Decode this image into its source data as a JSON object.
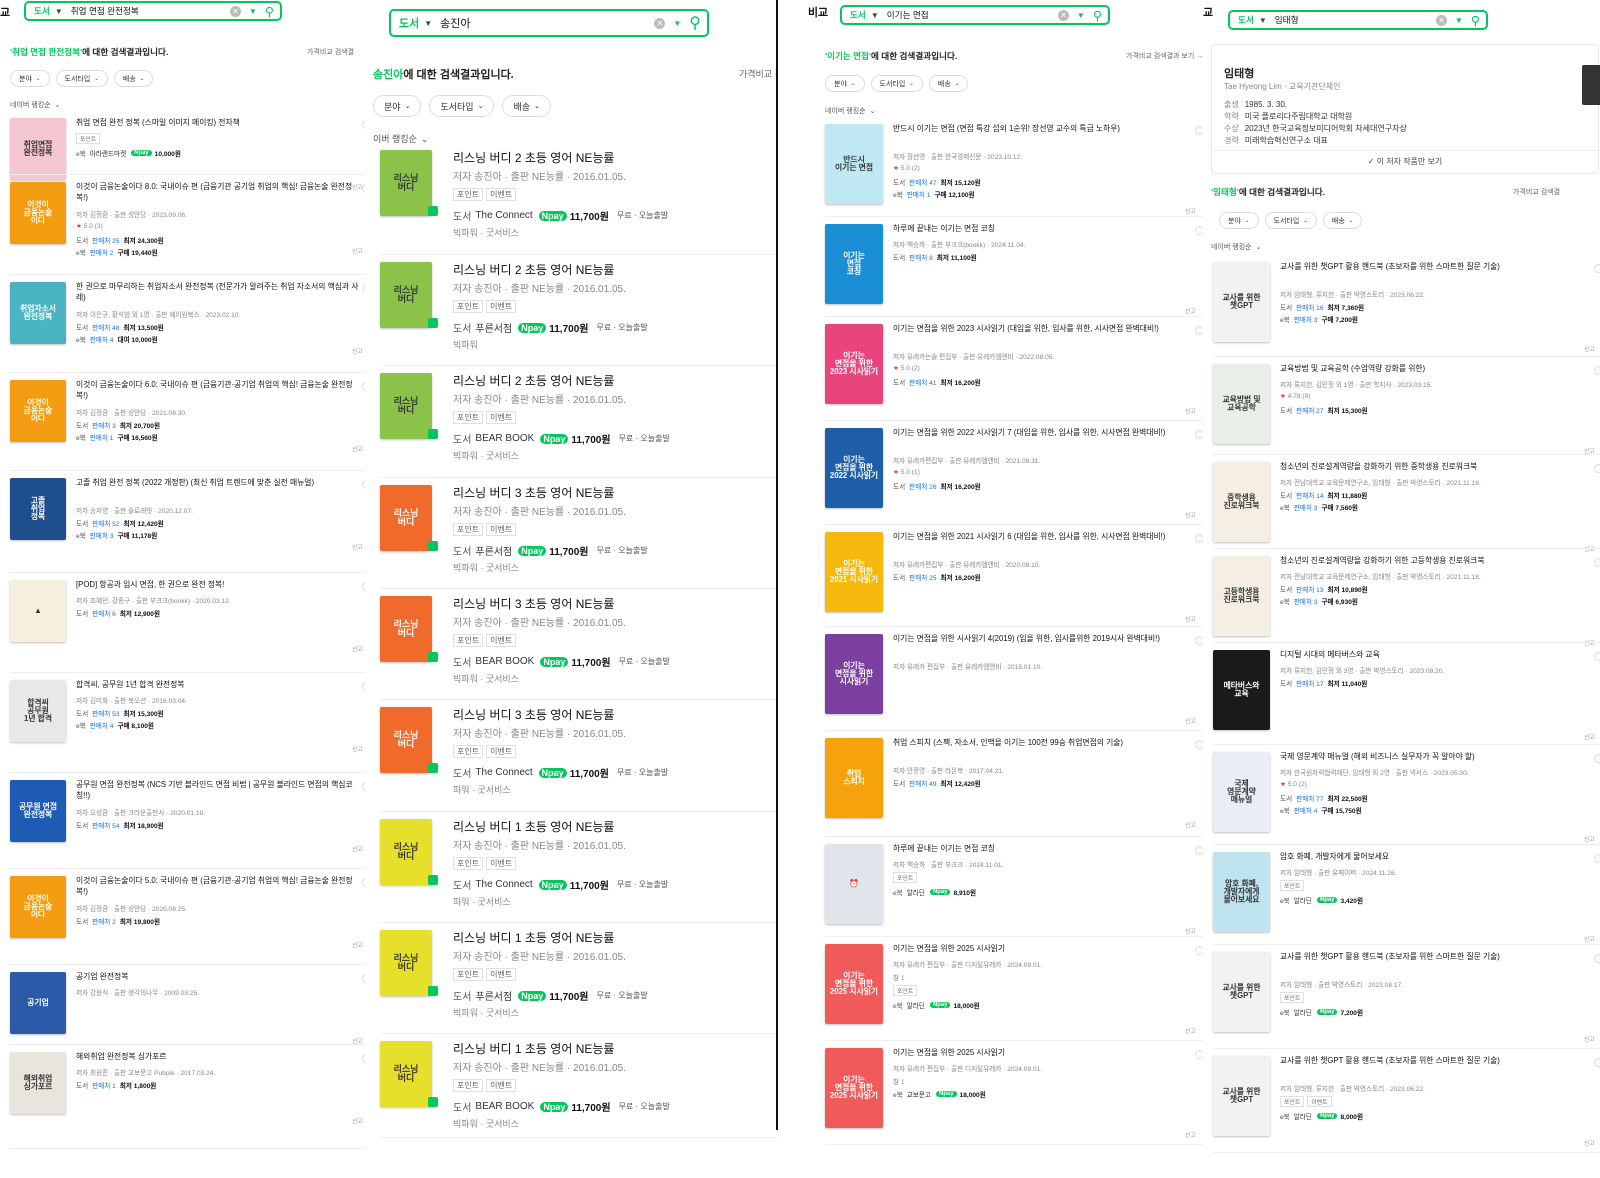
{
  "panels": {
    "p1": {
      "edge_label": "교",
      "search": {
        "category": "도서",
        "query": "취업 면접 완전정복"
      },
      "result": {
        "query": "'취업 면접 완전정복'",
        "suffix": "에 대한 검색결과입니다."
      },
      "price_compare": "가격비교 검색결",
      "filters": [
        "분야",
        "도서타입",
        "배송"
      ],
      "sort": "네이버 랭킹순",
      "items": [
        {
          "title": "취업 면접 완전 정복 (스마일 이미지 메이킹) 전자책",
          "badges": [
            "포인트"
          ],
          "lines": [
            {
              "type": "e북",
              "store": "아라랜드마켓",
              "npay": true,
              "price": "10,000원"
            }
          ],
          "cover": "#f4c6cf",
          "cover_text": "취업면접\n완전정복"
        },
        {
          "title": "이것이 금융논술이다 8.0: 국내이슈 편 (금융기관 공기업 취업의 핵심! 금융논술 완전정복!)",
          "meta": "저자 김정환 · 출판 성안당 · 2023.09.06.",
          "rating": "5.0 (3)",
          "lines": [
            {
              "type": "도서",
              "sellers": "판매처 25",
              "price": "최저 24,300원"
            },
            {
              "type": "e북",
              "sellers": "판매처 2",
              "price": "구매 19,440원"
            }
          ],
          "cover": "#f39c12",
          "cover_text": "이것이\n금융논술\n이다"
        },
        {
          "title": "한 권으로 마무리하는 취업자소서 완전정복 (전문가가 알려주는 취업 자소서의 핵심과 사례)",
          "meta": "저자 이은규, 황석범 외 1명 · 출판 예이원북스 · 2023.02.10.",
          "lines": [
            {
              "type": "도서",
              "sellers": "판매처 48",
              "price": "최저 13,500원"
            },
            {
              "type": "e북",
              "sellers": "판매처 4",
              "price": "대여 10,000원"
            }
          ],
          "cover": "#4ab3c4",
          "cover_text": "취업자소서\n완전정복"
        },
        {
          "title": "이것이 금융논술이다 6.0: 국내이슈 편 (금융기관·공기업 취업의 핵심! 금융논술 완전정복!)",
          "meta": "저자 김정환 · 출판 성안당 · 2021.08.30.",
          "lines": [
            {
              "type": "도서",
              "sellers": "판매처 3",
              "price": "최저 20,700원"
            },
            {
              "type": "e북",
              "sellers": "판매처 1",
              "price": "구매 16,560원"
            }
          ],
          "cover": "#f39c12",
          "cover_text": "이것이\n금융논술\n이다"
        },
        {
          "title": "고졸 취업 완전 정복 (2022 개정판) (최신 취업 트렌드에 맞춘 실전 매뉴얼)",
          "meta": "저자 송지영 · 출판 슬로래빗 · 2020.12.07.",
          "lines": [
            {
              "type": "도서",
              "sellers": "판매처 52",
              "price": "최저 12,420원"
            },
            {
              "type": "e북",
              "sellers": "판매처 3",
              "price": "구매 11,178원"
            }
          ],
          "cover": "#1f4e8c",
          "cover_text": "고졸\n취업\n정복"
        },
        {
          "title": "[POD] 항공과 입시 면접, 한 권으로 완전 정복!",
          "meta": "저자 조혜민, 강종구 · 출판 부크크(bookk) · 2020.03.12.",
          "lines": [
            {
              "type": "도서",
              "sellers": "판매처 6",
              "price": "최저 12,900원"
            }
          ],
          "cover": "#f5efe0",
          "cover_text": "▲"
        },
        {
          "title": "합격씨, 공무원 1년 합격 완전정복",
          "meta": "저자 김미화 · 출판 북오션 · 2016.03.04.",
          "lines": [
            {
              "type": "도서",
              "sellers": "판매처 53",
              "price": "최저 15,300원"
            },
            {
              "type": "e북",
              "sellers": "판매처 4",
              "price": "구매 8,100원"
            }
          ],
          "cover": "#e8e8e8",
          "cover_text": "합격씨\n공무원\n1년 합격"
        },
        {
          "title": "공무원 면접 완전정복 (NCS 기반 블라인드 면접 비법 | 공무원 블라인드 면접의 핵심코칭!!)",
          "meta": "저자 오성환 · 출판 크라운출판사 · 2020.01.10.",
          "lines": [
            {
              "type": "도서",
              "sellers": "판매처 54",
              "price": "최저 18,900원"
            }
          ],
          "cover": "#1e5bb5",
          "cover_text": "공무원 면접\n완전정복"
        },
        {
          "title": "이것이 금융논술이다 5.0: 국내이슈 편 (금융기관·공기업 취업의 핵심! 금융논술 완전정복!)",
          "meta": "저자 김정환 · 출판 성안당 · 2020.08.25.",
          "lines": [
            {
              "type": "도서",
              "sellers": "판매처 2",
              "price": "최저 19,800원"
            }
          ],
          "cover": "#f39c12",
          "cover_text": "이것이\n금융논술\n이다"
        },
        {
          "title": "공기업 완전정복",
          "meta": "저자 강용식 · 출판 생각의나무 · 2009.09.25.",
          "lines": [],
          "cover": "#2a5aa8",
          "cover_text": "공기업"
        },
        {
          "title": "해외취업 완전정복 싱가포르",
          "meta": "저자 최원준 · 출판 교보문고 Pubple · 2017.03.24.",
          "lines": [
            {
              "type": "도서",
              "sellers": "판매처 1",
              "price": "최저 1,800원"
            }
          ],
          "cover": "#e9e4dc",
          "cover_text": "해외취업\n싱가포르"
        }
      ]
    },
    "p2": {
      "search": {
        "category": "도서",
        "query": "송진아"
      },
      "result": {
        "query": "송진아",
        "suffix": "에 대한 검색결과입니다."
      },
      "price_compare": "가격비교 검색결과",
      "filters": [
        "분야",
        "도서타입",
        "배송"
      ],
      "sort": "이버 랭킹순",
      "items": [
        {
          "title": "리스닝 버디 2 초등 영어 NE능률",
          "meta": "저자 송진아 · 출판 NE능률 · 2016.01.05.",
          "store": "The Connect",
          "price": "11,700원",
          "ship": "무료 · 오늘출발",
          "ext": "빅파워 · 굿서비스",
          "cover": "#8bc34a"
        },
        {
          "title": "리스닝 버디 2 초등 영어 NE능률",
          "meta": "저자 송진아 · 출판 NE능률 · 2016.01.05.",
          "store": "푸른서점",
          "price": "11,700원",
          "ship": "무료 · 오늘출발",
          "ext": "빅파워",
          "cover": "#8bc34a"
        },
        {
          "title": "리스닝 버디 2 초등 영어 NE능률",
          "meta": "저자 송진아 · 출판 NE능률 · 2016.01.05.",
          "store": "BEAR BOOK",
          "price": "11,700원",
          "ship": "무료 · 오늘출발",
          "ext": "빅파워 · 굿서비스",
          "cover": "#8bc34a"
        },
        {
          "title": "리스닝 버디 3 초등 영어 NE능률",
          "meta": "저자 송진아 · 출판 NE능률 · 2016.01.05.",
          "store": "푸른서점",
          "price": "11,700원",
          "ship": "무료 · 오늘출발",
          "ext": "빅파워 · 굿서비스",
          "cover": "#f06a2b"
        },
        {
          "title": "리스닝 버디 3 초등 영어 NE능률",
          "meta": "저자 송진아 · 출판 NE능률 · 2016.01.05.",
          "store": "BEAR BOOK",
          "price": "11,700원",
          "ship": "무료 · 오늘출발",
          "ext": "빅파워 · 굿서비스",
          "cover": "#f06a2b"
        },
        {
          "title": "리스닝 버디 3 초등 영어 NE능률",
          "meta": "저자 송진아 · 출판 NE능률 · 2016.01.05.",
          "store": "The Connect",
          "price": "11,700원",
          "ship": "무료 · 오늘출발",
          "ext": "파워 · 굿서비스",
          "cover": "#f06a2b"
        },
        {
          "title": "리스닝 버디 1 초등 영어 NE능률",
          "meta": "저자 송진아 · 출판 NE능률 · 2016.01.05.",
          "store": "The Connect",
          "price": "11,700원",
          "ship": "무료 · 오늘출발",
          "ext": "파워 · 굿서비스",
          "cover": "#e6e02b"
        },
        {
          "title": "리스닝 버디 1 초등 영어 NE능률",
          "meta": "저자 송진아 · 출판 NE능률 · 2016.01.05.",
          "store": "푸른서점",
          "price": "11,700원",
          "ship": "무료 · 오늘출발",
          "ext": "빅파워 · 굿서비스",
          "cover": "#e6e02b"
        },
        {
          "title": "리스닝 버디 1 초등 영어 NE능률",
          "meta": "저자 송진아 · 출판 NE능률 · 2016.01.05.",
          "store": "BEAR BOOK",
          "price": "11,700원",
          "ship": "무료 · 오늘출발",
          "ext": "빅파워 · 굿서비스",
          "cover": "#e6e02b"
        }
      ]
    },
    "p3": {
      "edge_label": "비교",
      "search": {
        "category": "도서",
        "query": "이기는 면접"
      },
      "result": {
        "query": "'이기는 면접'",
        "suffix": "에 대한 검색결과입니다."
      },
      "price_compare": "가격비교 검색결과 보기 →",
      "filters": [
        "분야",
        "도서타입",
        "배송"
      ],
      "sort": "네이버 랭킹순",
      "items": [
        {
          "title": "반드시 이기는 면접 (면접 특강 섭외 1순위! 장선영 교수의 특급 노하우)",
          "meta": "저자 장선영 · 출판 한국경제신문 · 2023.10.12.",
          "rating": "5.0 (2)",
          "lines": [
            {
              "type": "도서",
              "sellers": "판매처 47",
              "price": "최저 15,120원"
            },
            {
              "type": "e북",
              "sellers": "판매처 1",
              "price": "구매 12,100원"
            }
          ],
          "cover": "#bfe8f2",
          "cover_text": "반드시\n이기는 면접"
        },
        {
          "title": "하루에 끝내는 이기는 면접 코칭",
          "meta": "저자 백승하 · 출판 부크크(bookk) · 2024.11.04.",
          "lines": [
            {
              "type": "도서",
              "sellers": "판매처 8",
              "price": "최저 11,100원"
            }
          ],
          "cover": "#1b8fd6",
          "cover_text": "이기는\n면접\n코칭"
        },
        {
          "title": "이기는 면접을 위한 2023 시사읽기 (대입을 위한, 입사를 위한, 시사면접 완벽대비!)",
          "meta": "저자 유레카논술 편집부 · 출판 유레카엠앤비 · 2022.08.05.",
          "rating": "5.0 (2)",
          "lines": [
            {
              "type": "도서",
              "sellers": "판매처 41",
              "price": "최저 16,200원"
            }
          ],
          "cover": "#e8457c",
          "cover_text": "이기는\n면접을 위한\n2023 시사읽기"
        },
        {
          "title": "이기는 면접을 위한 2022 시사읽기 7 (대입을 위한, 입사를 위한, 시사면접 완벽대비!)",
          "meta": "저자 유레카편집부 · 출판 유레카엠앤비 · 2021.08.31.",
          "rating": "5.0 (1)",
          "lines": [
            {
              "type": "도서",
              "sellers": "판매처 26",
              "price": "최저 16,200원"
            }
          ],
          "cover": "#1f5fa8",
          "cover_text": "이기는\n면접을 위한\n2022 시사읽기"
        },
        {
          "title": "이기는 면접을 위한 2021 시사읽기 6 (대입을 위한, 입사를 위한, 시사면접 완벽대비!)",
          "meta": "저자 유레카편집부 · 출판 유레카엠앤비 · 2020.08.10.",
          "lines": [
            {
              "type": "도서",
              "sellers": "판매처 25",
              "price": "최저 16,200원"
            }
          ],
          "cover": "#f5b80d",
          "cover_text": "이기는\n면접을 위한\n2021 시사읽기"
        },
        {
          "title": "이기는 면접을 위한 시사읽기 4(2019) (입을 위한, 입사를위한 2019시사 완벽대비!)",
          "meta": "저자 유레카 편집부 · 출판 유레카엠앤비 · 2019.01.10.",
          "lines": [],
          "cover": "#7b3fa0",
          "cover_text": "이기는\n면접을 위한\n시사읽기"
        },
        {
          "title": "취업 스피치 (스펙, 자소서, 인맥을 이기는 100전 99승 취업면접의 기술)",
          "meta": "저자 안정명 · 출판 라온북 · 2017.04.21.",
          "lines": [
            {
              "type": "도서",
              "sellers": "판매처 49",
              "price": "최저 12,420원"
            }
          ],
          "cover": "#f5a20d",
          "cover_text": "취업\n스피치"
        },
        {
          "title": "하루에 끝내는 이기는 면접 코칭",
          "meta": "저자 백승하 · 출판 부크크 · 2024.11.01.",
          "badges": [
            "포인트"
          ],
          "lines": [
            {
              "type": "e북",
              "store": "알라딘",
              "npay": true,
              "price": "8,910원"
            }
          ],
          "cover": "#dfe5ea",
          "cover_text": "⏰"
        },
        {
          "title": "이기는 면접을 위한 2025 시사읽기",
          "meta": "저자 유레카 편집부 · 출판 디지털유레카 · 2024.09.01.",
          "vol": "참 1",
          "badges": [
            "포인트"
          ],
          "lines": [
            {
              "type": "e북",
              "store": "알라딘",
              "npay": true,
              "price": "18,000원"
            }
          ],
          "cover": "#f05a5a",
          "cover_text": "이기는\n면접을 위한\n2025 시사읽기"
        },
        {
          "title": "이기는 면접을 위한 2025 시사읽기",
          "meta": "저자 유레카 편집부 · 출판 디지털유레카 · 2024.09.01.",
          "vol": "참 1",
          "lines": [
            {
              "type": "e북",
              "store": "교보문고",
              "npay": true,
              "price": "18,000원"
            }
          ],
          "cover": "#f05a5a",
          "cover_text": "이기는\n면접을 위한\n2025 시사읽기"
        }
      ]
    },
    "p4": {
      "edge_label": "교",
      "search": {
        "category": "도서",
        "query": "임태형"
      },
      "author": {
        "name": "임태형",
        "roman": "Tae Hyeong Lim",
        "field": "교육기관단체인",
        "birth_label": "출생",
        "birth": "1985. 3. 30.",
        "school_label": "학력",
        "school": "미국 플로리다주립대학교 대학원",
        "award_label": "수상",
        "award": "2023년 한국교육정보미디어학회 차세대연구자상",
        "career_label": "경력",
        "career": "미래학습혁신연구소 대표",
        "more": "✓ 이 저자 작품만 보기"
      },
      "result": {
        "query": "'임태형'",
        "suffix": "에 대한 검색결과입니다."
      },
      "price_compare": "가격비교 검색결",
      "filters": [
        "분야",
        "도서타입",
        "배송"
      ],
      "sort": "네이버 랭킹순",
      "items": [
        {
          "title": "교사를 위한 챗GPT 활용 핸드북 (초보자를 위한 스마트한 질문 기술)",
          "meta": "저자 임태형, 류지헌 · 출판 박영스토리 · 2023.06.22.",
          "lines": [
            {
              "type": "도서",
              "sellers": "판매처 16",
              "price": "최저 7,360원"
            },
            {
              "type": "e북",
              "sellers": "판매처 3",
              "price": "구매 7,200원"
            }
          ],
          "cover": "#f2f2f2",
          "cover_text": "교사를 위한\n챗GPT"
        },
        {
          "title": "교육방법 및 교육공학 (수업역량 강화를 위한)",
          "meta": "저자 류지헌, 김민정 외 1명 · 출판 학지사 · 2023.03.15.",
          "rating": "4.78 (9)",
          "lines": [
            {
              "type": "도서",
              "sellers": "판매처 27",
              "price": "최저 15,300원"
            }
          ],
          "cover": "#e8efe8",
          "cover_text": "교육방법 및\n교육공학"
        },
        {
          "title": "청소년의 진로설계역량을 강화하기 위한 중학생용 진로워크북",
          "meta": "저자 전남대학교 교육문제연구소, 임태형 · 출판 박영스토리 · 2021.11.18.",
          "lines": [
            {
              "type": "도서",
              "sellers": "판매처 14",
              "price": "최저 11,880원"
            },
            {
              "type": "e북",
              "sellers": "판매처 3",
              "price": "구매 7,560원"
            }
          ],
          "cover": "#f4efe2",
          "cover_text": "중학생용\n진로워크북"
        },
        {
          "title": "청소년의 진로설계역량을 강화하기 위한 고등학생용 진로워크북",
          "meta": "저자 전남대학교 교육문제연구소, 임태형 · 출판 박영스토리 · 2021.11.18.",
          "lines": [
            {
              "type": "도서",
              "sellers": "판매처 13",
              "price": "최저 10,890원"
            },
            {
              "type": "e북",
              "sellers": "판매처 3",
              "price": "구매 6,930원"
            }
          ],
          "cover": "#f4efe2",
          "cover_text": "고등학생용\n진로워크북"
        },
        {
          "title": "디지털 시대의 메타버스와 교육",
          "meta": "저자 류지헌, 김민정 외 3명 · 출판 박영스토리 · 2023.08.20.",
          "lines": [
            {
              "type": "도서",
              "sellers": "판매처 17",
              "price": "최저 11,040원"
            }
          ],
          "cover": "#1a1a1a",
          "cover_text": "메타버스와\n교육"
        },
        {
          "title": "국제 영문계약 매뉴얼 (해외 비즈니스 실무자가 꼭 알아야 할)",
          "meta": "저자 한국원자력협력재단, 임태형 외 2명 · 출판 넥서스 · 2023.05.30.",
          "rating": "5.0 (2)",
          "lines": [
            {
              "type": "도서",
              "sellers": "판매처 77",
              "price": "최저 22,500원"
            },
            {
              "type": "e북",
              "sellers": "판매처 4",
              "price": "구매 15,750원"
            }
          ],
          "cover": "#e9eef4",
          "cover_text": "국제\n영문계약\n매뉴얼"
        },
        {
          "title": "암호 화폐, 개발자에게 물어보세요",
          "meta": "저자 임태형 · 출판 유페이퍼 · 2024.11.26.",
          "badges": [
            "포인트"
          ],
          "lines": [
            {
              "type": "e북",
              "store": "알라딘",
              "npay": true,
              "price": "3,420원"
            }
          ],
          "cover": "#bfe3ef",
          "cover_text": "암호 화폐,\n개발자에게\n물어보세요"
        },
        {
          "title": "교사를 위한 챗GPT 활용 핸드북 (초보자를 위한 스마트한 질문 기술)",
          "meta": "저자 임태형 · 출판 박영스토리 · 2023.08.17.",
          "badges": [
            "포인트"
          ],
          "lines": [
            {
              "type": "e북",
              "store": "알라딘",
              "npay": true,
              "price": "7,200원"
            }
          ],
          "cover": "#f2f2f2",
          "cover_text": "교사를 위한\n챗GPT"
        },
        {
          "title": "교사를 위한 챗GPT 활용 핸드북 (초보자를 위한 스마트한 질문 기술)",
          "meta": "저자 임태형, 류지헌 · 출판 박영스토리 · 2023.06.22.",
          "badges": [
            "포인트",
            "이벤트"
          ],
          "lines": [
            {
              "type": "e북",
              "store": "알라딘",
              "npay": true,
              "price": "8,000원"
            }
          ],
          "cover": "#f2f2f2",
          "cover_text": "교사를 위한\n챗GPT"
        }
      ]
    }
  },
  "common": {
    "report": "신고",
    "heart": "♡",
    "npay": "pay",
    "lines_label_badge_point": "포인트",
    "badge_event": "이벤트",
    "author_label": "저자",
    "publisher_label": "출판",
    "store_label": "도서"
  }
}
